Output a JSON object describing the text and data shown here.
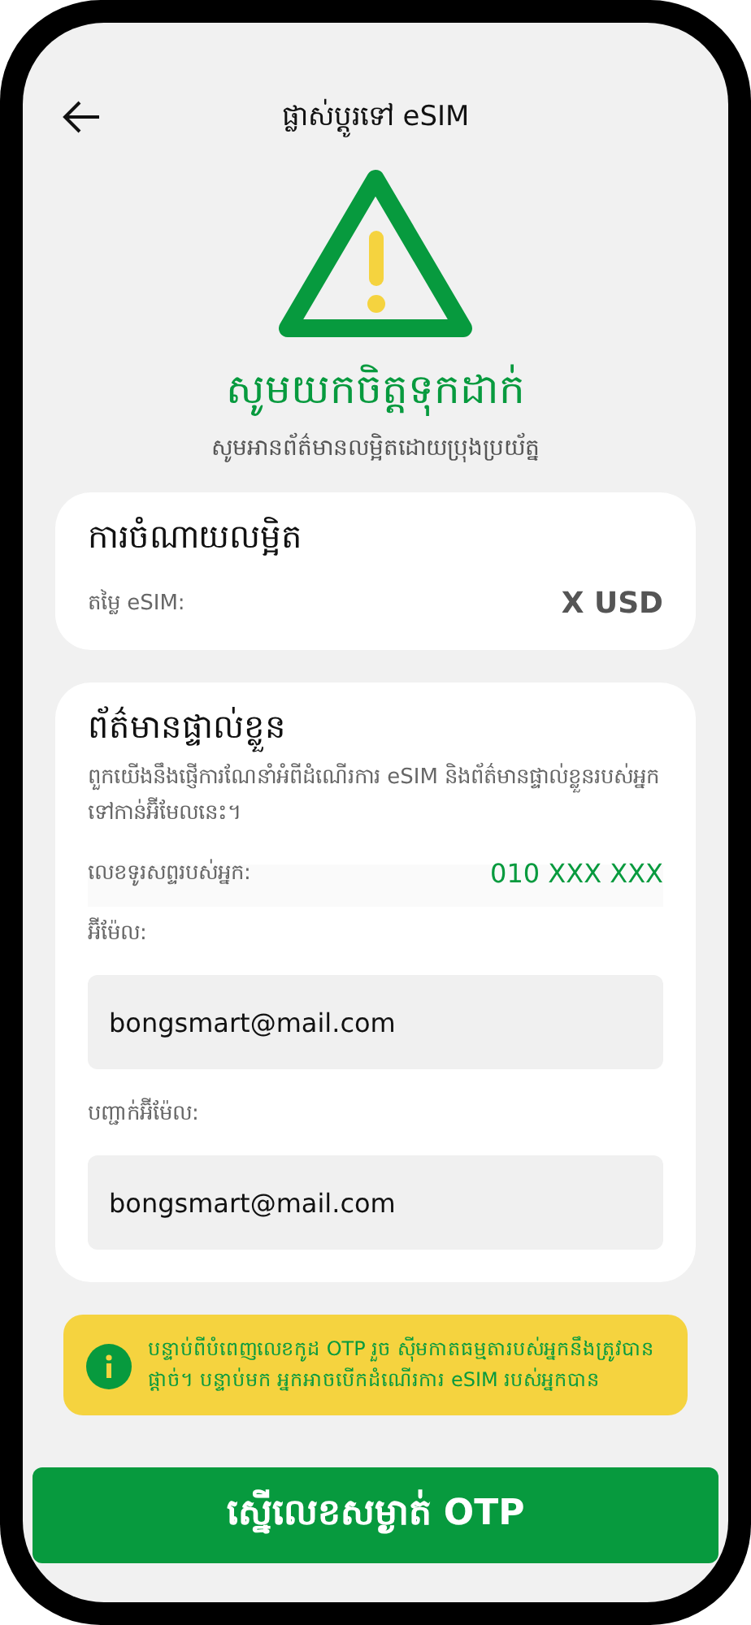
{
  "header": {
    "title": "ផ្លាស់ប្តូរទៅ eSIM"
  },
  "warning": {
    "heading": "សូមយកចិត្តទុកដាក់",
    "subtitle": "សូមអានព័ត៌មានលម្អិតដោយប្រុងប្រយ័ត្ន"
  },
  "fee_card": {
    "title": "ការចំណាយលម្អិត",
    "label": "តម្លៃ eSIM:",
    "value": "X USD"
  },
  "personal_card": {
    "title": "ព័ត៌មានផ្ទាល់ខ្លួន",
    "description": "ពួកយើងនឹងផ្ញើការណែនាំអំពីដំណើរការ eSIM និងព័ត៌មានផ្ទាល់ខ្លួនរបស់អ្នកទៅកាន់អ៊ីមែលនេះ។",
    "phone_label": "លេខទូរសព្ទរបស់អ្នក:",
    "phone_value": "010 XXX XXX",
    "fields": [
      {
        "label": "អ៊ីម៉ែល:",
        "value": "bongsmart@mail.com"
      },
      {
        "label": "បញ្ជាក់អ៊ីម៉ែល:",
        "value": "bongsmart@mail.com"
      }
    ]
  },
  "notice": {
    "text": "បន្ទាប់ពីបំពេញលេខកូដ OTP រួច ស៊ីមកាតធម្មតារបស់អ្នកនឹងត្រូវបានផ្តាច់។ បន្ទាប់មក អ្នកអាចបើកដំណើរការ eSIM របស់អ្នកបាន"
  },
  "primary_button": {
    "label": "ស្នើលេខសម្ងាត់ OTP"
  }
}
